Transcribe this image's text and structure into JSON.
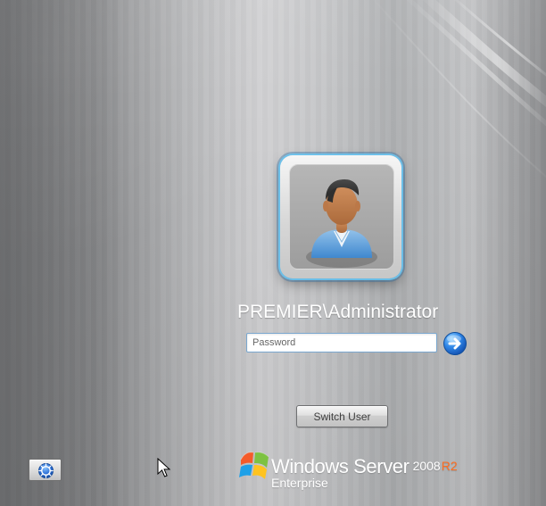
{
  "login": {
    "user_name": "PREMIER\\Administrator",
    "password": {
      "value": "",
      "placeholder": "Password"
    },
    "switch_user_label": "Switch User"
  },
  "branding": {
    "name": "Windows Server",
    "version": "2008",
    "release": "R2",
    "edition": "Enterprise"
  },
  "controls": {
    "submit_icon": "arrow-right-icon",
    "ease_of_access_icon": "ease-of-access-icon",
    "cursor_icon": "mouse-pointer-icon"
  },
  "colors": {
    "accent_blue": "#1f74d9",
    "accent_orange": "#ff6d1f",
    "avatar_glow": "#6cc4f0"
  }
}
